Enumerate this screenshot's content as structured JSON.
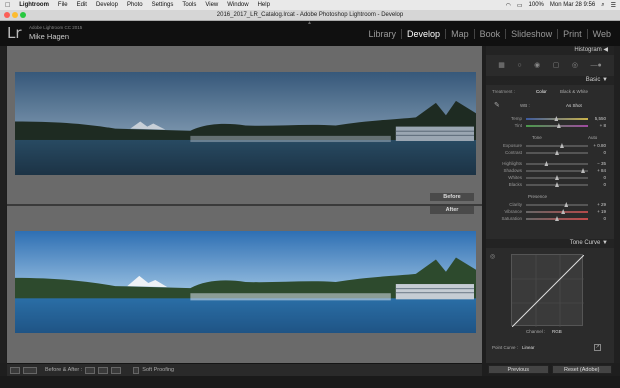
{
  "menubar": {
    "apple": "",
    "app": "Lightroom",
    "items": [
      "File",
      "Edit",
      "Develop",
      "Photo",
      "Settings",
      "Tools",
      "View",
      "Window",
      "Help"
    ],
    "status": {
      "battery": "100%",
      "datetime": "Mon Mar 28  9:56",
      "user": "100%"
    }
  },
  "window": {
    "title": "2016_2017_LR_Catalog.lrcat - Adobe Photoshop Lightroom - Develop"
  },
  "identity": {
    "logo": "Lr",
    "product": "Adobe Lightroom CC 2015",
    "user": "Mike Hagen",
    "modules": [
      "Library",
      "Develop",
      "Map",
      "Book",
      "Slideshow",
      "Print",
      "Web"
    ],
    "active_module": "Develop"
  },
  "canvas": {
    "before_label": "Before",
    "after_label": "After"
  },
  "toolbar": {
    "before_after_label": "Before & After :",
    "soft_proofing": "Soft Proofing"
  },
  "panel": {
    "histogram": "Histogram",
    "basic": "Basic",
    "treatment_label": "Treatment :",
    "treatment_color": "Color",
    "treatment_bw": "Black & White",
    "wb_label": "WB :",
    "wb_value": "As Shot",
    "temp": {
      "label": "Temp",
      "value": "5,550"
    },
    "tint": {
      "label": "Tint",
      "value": "+ 8"
    },
    "tone_label": "Tone",
    "auto_label": "Auto",
    "exposure": {
      "label": "Exposure",
      "value": "+ 0.80"
    },
    "contrast": {
      "label": "Contrast",
      "value": "0"
    },
    "highlights": {
      "label": "Highlights",
      "value": "− 35"
    },
    "shadows": {
      "label": "Shadows",
      "value": "+ 84"
    },
    "whites": {
      "label": "Whites",
      "value": "0"
    },
    "blacks": {
      "label": "Blacks",
      "value": "0"
    },
    "presence_label": "Presence",
    "clarity": {
      "label": "Clarity",
      "value": "+ 29"
    },
    "vibrance": {
      "label": "Vibrance",
      "value": "+ 19"
    },
    "saturation": {
      "label": "Saturation",
      "value": "0"
    },
    "tone_curve": "Tone Curve",
    "channel_label": "Channel :",
    "channel_value": "RGB",
    "point_curve_label": "Point Curve :",
    "point_curve_value": "Linear",
    "previous": "Previous",
    "reset": "Reset (Adobe)"
  },
  "sliders": {
    "temp": 0.49,
    "tint": 0.53,
    "exposure": 0.58,
    "contrast": 0.5,
    "highlights": 0.33,
    "shadows": 0.92,
    "whites": 0.5,
    "blacks": 0.5,
    "clarity": 0.65,
    "vibrance": 0.6,
    "saturation": 0.5
  }
}
